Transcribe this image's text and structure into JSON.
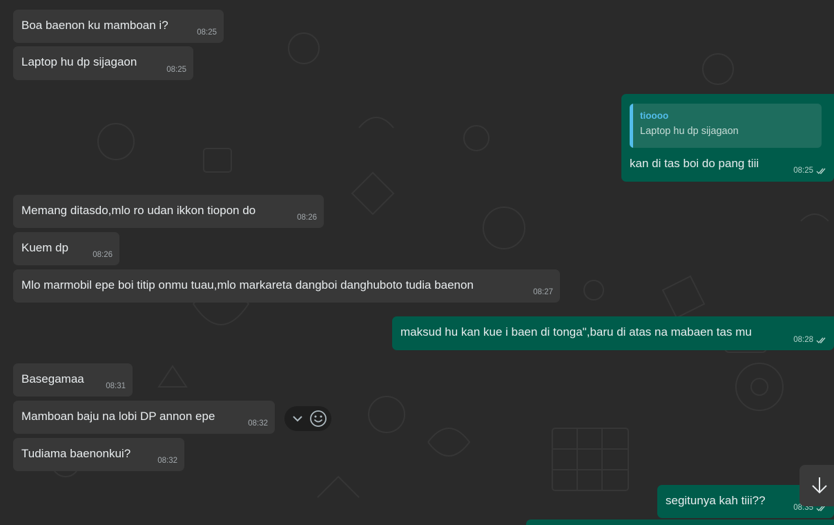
{
  "theme": {
    "background": "#2a2a2a",
    "incoming_bubble": "#383838",
    "outgoing_bubble": "#005c4b",
    "quote_accent": "#53bdeb",
    "tick_color": "#b6d3cc"
  },
  "messages": [
    {
      "direction": "incoming",
      "text": "Boa baenon ku mamboan i?",
      "time": "08:25"
    },
    {
      "direction": "incoming",
      "text": "Laptop hu dp sijagaon",
      "time": "08:25"
    },
    {
      "direction": "outgoing",
      "text": "kan di tas boi do pang tiii",
      "time": "08:25",
      "status": "read",
      "reply_to": {
        "author": "tioooo",
        "text": "Laptop hu dp sijagaon"
      }
    },
    {
      "direction": "incoming",
      "text": "Memang ditasdo,mlo ro udan ikkon tiopon do",
      "time": "08:26"
    },
    {
      "direction": "incoming",
      "text": "Kuem dp",
      "time": "08:26"
    },
    {
      "direction": "incoming",
      "text": "Mlo marmobil epe boi titip onmu tuau,mlo markareta dangboi danghuboto tudia baenon",
      "time": "08:27"
    },
    {
      "direction": "outgoing",
      "text": "maksud hu kan kue i baen di tonga\",baru di atas na mabaen tas mu",
      "time": "08:28",
      "status": "read"
    },
    {
      "direction": "incoming",
      "text": "Basegamaa",
      "time": "08:31"
    },
    {
      "direction": "incoming",
      "text": "Mamboan baju na lobi DP annon epe",
      "time": "08:32"
    },
    {
      "direction": "incoming",
      "text": "Tudiama baenonkui?",
      "time": "08:32"
    },
    {
      "direction": "outgoing",
      "text": "segitunya kah tiii??",
      "time": "08:35",
      "status": "read"
    }
  ],
  "hover_actions": [
    {
      "icon": "chevron-down-icon"
    },
    {
      "icon": "emoji-icon"
    }
  ],
  "scroll_button": {
    "icon": "arrow-down-icon"
  }
}
